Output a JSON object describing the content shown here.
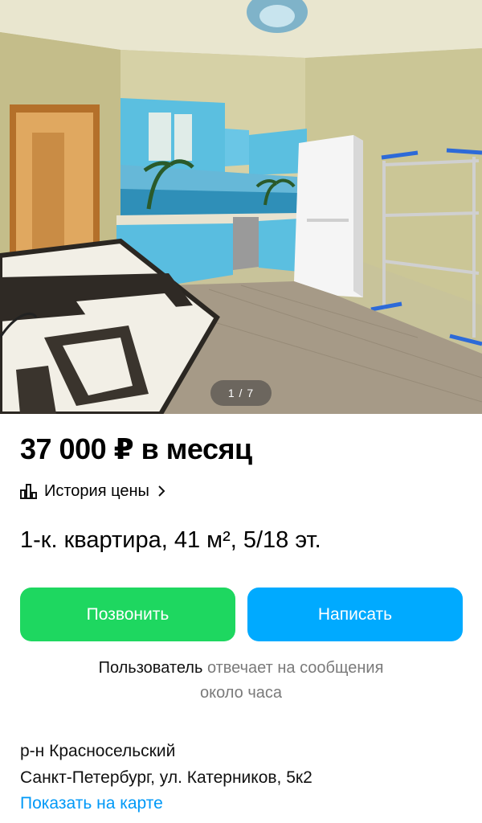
{
  "photo": {
    "alt_subject": "kitchen",
    "current": 1,
    "total": 7,
    "counter_text": "1 / 7"
  },
  "listing": {
    "price": "37 000 ₽ в месяц",
    "price_history_label": "История цены",
    "title": "1-к. квартира, 41 м², 5/18 эт."
  },
  "actions": {
    "call_label": "Позвонить",
    "write_label": "Написать"
  },
  "seller": {
    "reply_user": "Пользователь",
    "reply_text_line1": "отвечает на сообщения",
    "reply_text_line2": "около часа"
  },
  "address": {
    "district": "р-н Красносельский",
    "street": "Санкт-Петербург, ул. Катерников, 5к2",
    "map_link": "Показать на карте"
  },
  "colors": {
    "call_button": "#1ed760",
    "write_button": "#00aaff",
    "link": "#0099f7"
  },
  "icons": {
    "history": "bar-chart-icon",
    "chevron": "chevron-right-icon"
  }
}
